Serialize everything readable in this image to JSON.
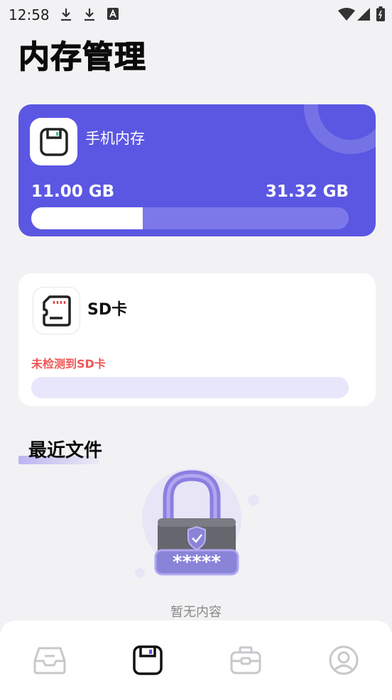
{
  "status_bar": {
    "time": "12:58"
  },
  "page": {
    "title": "内存管理"
  },
  "phone_storage": {
    "label": "手机内存",
    "used": "11.00 GB",
    "total": "31.32 GB",
    "used_fraction": 0.351,
    "accent_color": "#5b57e2"
  },
  "sd_card": {
    "label": "SD卡",
    "status": "未检测到SD卡",
    "status_color": "#f05656"
  },
  "recent": {
    "title": "最近文件",
    "empty_text": "暂无内容"
  },
  "nav": {
    "items": [
      {
        "icon": "inbox-icon",
        "active": false
      },
      {
        "icon": "storage-icon",
        "active": true
      },
      {
        "icon": "toolbox-icon",
        "active": false
      },
      {
        "icon": "profile-icon",
        "active": false
      }
    ]
  }
}
